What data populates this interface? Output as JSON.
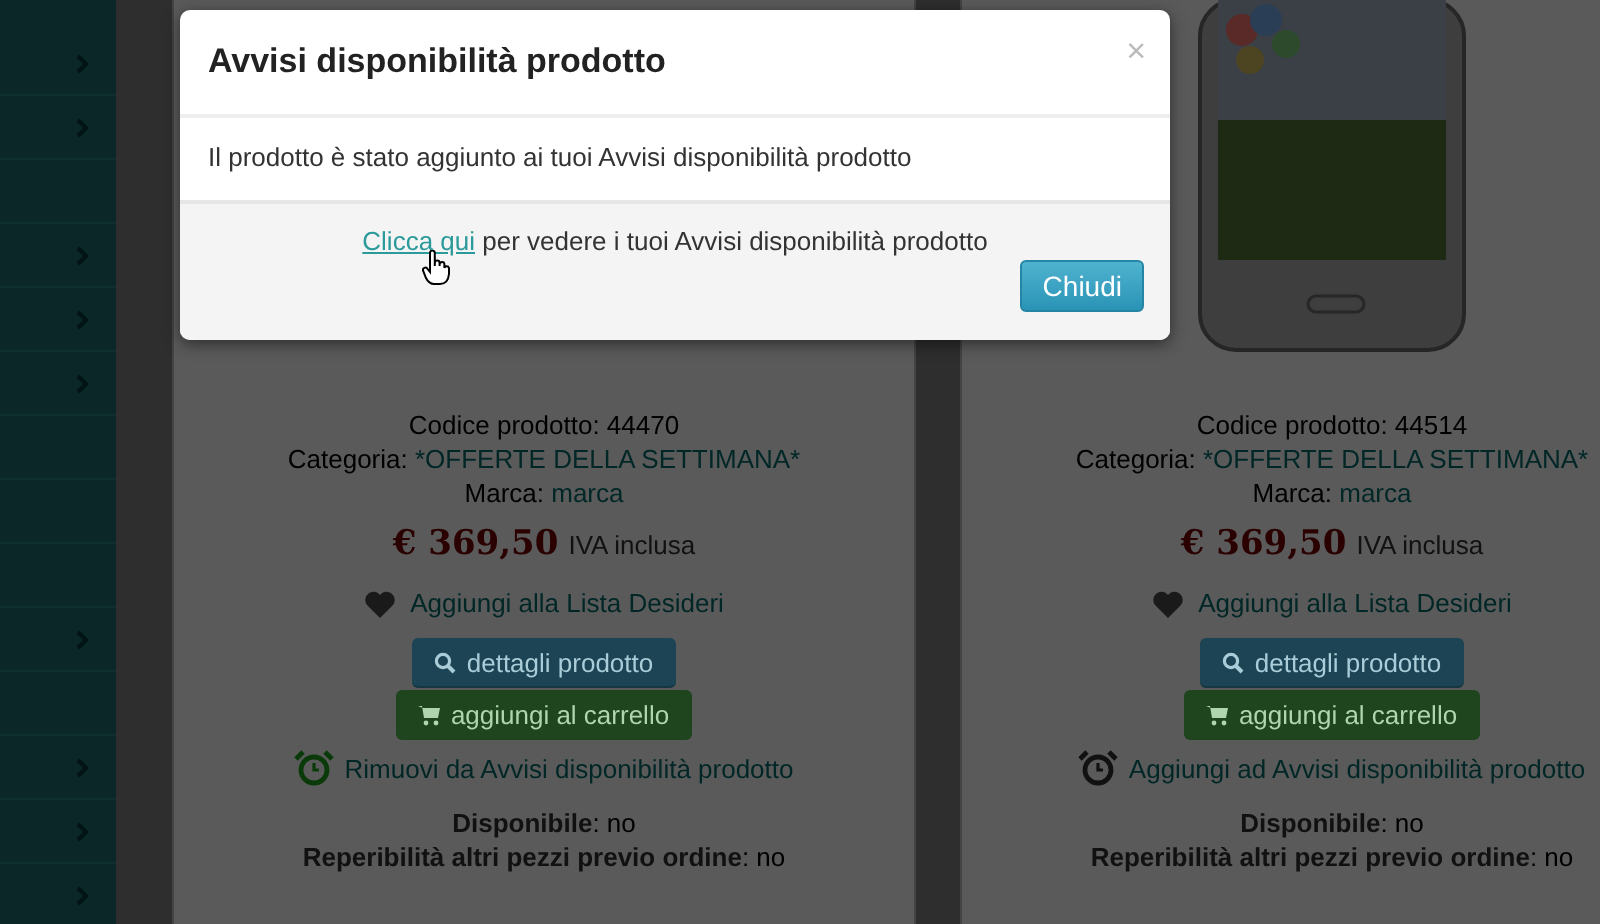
{
  "sidebar": {
    "items": [
      {
        "arrow": true
      },
      {
        "arrow": true
      },
      {
        "arrow": false
      },
      {
        "arrow": true
      },
      {
        "arrow": true
      },
      {
        "arrow": true
      },
      {
        "arrow": false
      },
      {
        "arrow": false
      },
      {
        "arrow": false
      },
      {
        "arrow": true
      },
      {
        "arrow": false
      },
      {
        "arrow": true
      },
      {
        "arrow": true
      },
      {
        "arrow": true
      }
    ]
  },
  "products": [
    {
      "code": "Codice prodotto: 44470",
      "category_label": "Categoria:",
      "category": "*OFFERTE DELLA SETTIMANA*",
      "brand_label": "Marca:",
      "brand": "marca",
      "price": "€ 369,50",
      "vat": "IVA inclusa",
      "wishlist": "Aggiungi alla Lista Desideri",
      "details_button": "dettagli prodotto",
      "cart_button": "aggiungi al carrello",
      "alert_link": "Rimuovi da Avvisi disponibilità prodotto",
      "alert_active": true,
      "availability": "**Disponibile**: no",
      "reorder": "**Reperibilità altri pezzi previo ordine**: no"
    },
    {
      "code": "Codice prodotto: 44514",
      "category_label": "Categoria:",
      "category": "*OFFERTE DELLA SETTIMANA*",
      "brand_label": "Marca:",
      "brand": "marca",
      "price": "€ 369,50",
      "vat": "IVA inclusa",
      "wishlist": "Aggiungi alla Lista Desideri",
      "details_button": "dettagli prodotto",
      "cart_button": "aggiungi al carrello",
      "alert_link": "Aggiungi ad Avvisi disponibilità prodotto",
      "alert_active": false,
      "availability": "**Disponibile**: no",
      "reorder": "**Reperibilità altri pezzi previo ordine**: no"
    }
  ],
  "modal": {
    "title": "Avvisi disponibilità prodotto",
    "close": "×",
    "message": "Il prodotto è stato aggiunto ai tuoi Avvisi disponibilità prodotto",
    "link": "Clicca qui",
    "link_suffix": " per vedere i tuoi Avvisi disponibilità prodotto",
    "button": "Chiudi"
  }
}
